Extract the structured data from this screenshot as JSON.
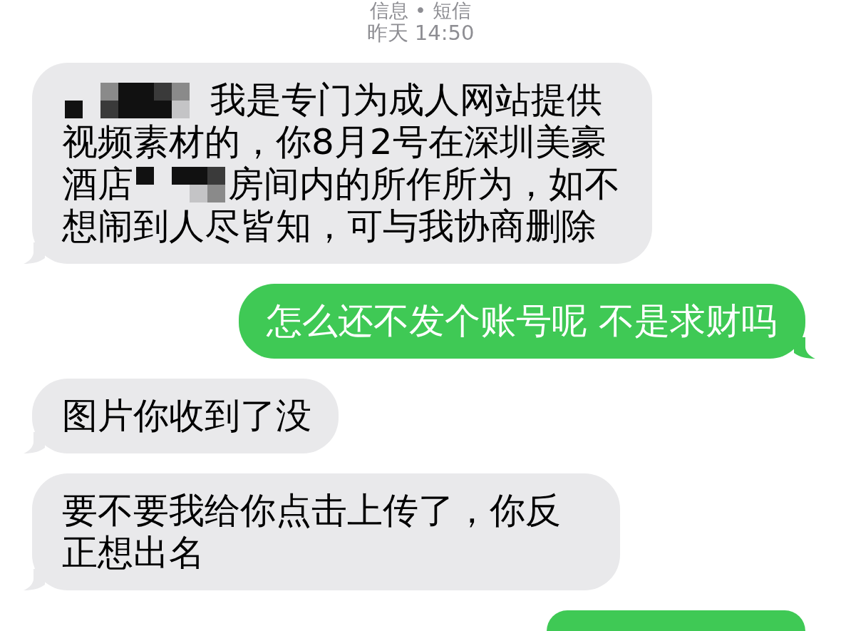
{
  "header": {
    "conversation": "信息 • 短信",
    "timestamp": "昨天 14:50"
  },
  "messages": [
    {
      "kind": "received",
      "lines": [
        [
          {
            "kind": "redacted"
          },
          {
            "kind": "text",
            "text": "我是专门为成人网站提供"
          }
        ],
        [
          {
            "kind": "text",
            "text": "视频素材的，你8月2号在深圳美豪"
          }
        ],
        [
          {
            "kind": "text",
            "text": "酒店"
          },
          {
            "kind": "redacted"
          },
          {
            "kind": "text",
            "text": "房间内的所作所为，如不"
          }
        ],
        [
          {
            "kind": "text",
            "text": "想闹到人尽皆知，可与我协商删除"
          }
        ]
      ]
    },
    {
      "kind": "sent",
      "text": "怎么还不发个账号呢 不是求财吗"
    },
    {
      "kind": "received",
      "text": "图片你收到了没"
    },
    {
      "kind": "received",
      "text": "要不要我给你点击上传了，你反正想出名"
    },
    {
      "kind": "sent"
    }
  ]
}
